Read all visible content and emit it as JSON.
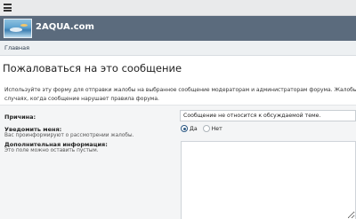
{
  "topbar": {
    "menu_icon": "hamburger-menu-icon"
  },
  "header": {
    "site_name": "2AQUA.com",
    "logo_icon": "aquarium-logo-image"
  },
  "breadcrumb": {
    "home": "Главная"
  },
  "page": {
    "title": "Пожаловаться на это сообщение",
    "intro_line1": "Используйте эту форму для отправки жалобы на выбранное сообщение модераторам и администраторам форума. Жалобы об",
    "intro_line2": "случаях, когда сообщение нарушает правила форума."
  },
  "form": {
    "reason": {
      "label": "Причина:",
      "value": "Сообщение не относится к обсуждаемой теме."
    },
    "notify": {
      "label": "Уведомить меня:",
      "hint": "Вас проинформируют о рассмотрении жалобы.",
      "options": [
        {
          "label": "Да",
          "checked": true
        },
        {
          "label": "Нет",
          "checked": false
        }
      ]
    },
    "additional": {
      "label": "Дополнительная информация:",
      "hint": "Это поле можно оставить пустым.",
      "value": ""
    }
  }
}
